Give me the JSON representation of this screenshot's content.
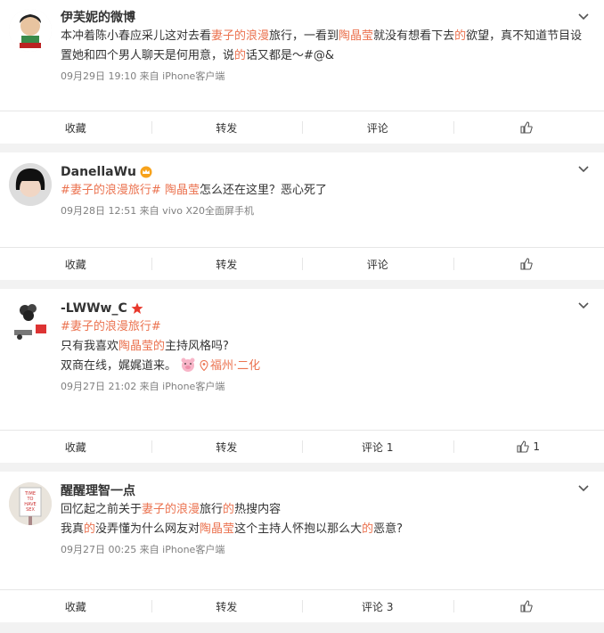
{
  "posts": [
    {
      "author": "伊芙妮的微博",
      "text": [
        [
          "本冲着陈小春应采儿这对去看",
          "",
          "妻子的浪漫",
          "hl",
          "旅行，一看到",
          "",
          "陶晶莹",
          "hl",
          "就没有想看下去",
          "",
          "的",
          "hl",
          "欲望，真不知道节目设置她和四个男人聊天是何用意，说",
          "",
          "的",
          "hl",
          "话又都是～#@&",
          ""
        ]
      ],
      "meta": "09月29日 19:10 来自 iPhone客户端",
      "actions": {
        "fav": "收藏",
        "repost": "转发",
        "comment": "评论",
        "like": ""
      }
    },
    {
      "author": "DanellaWu",
      "text": [
        [
          "#妻子的浪漫旅行#",
          "topic",
          " ",
          "",
          "陶晶莹",
          "hl",
          "怎么还在这里？恶心死了",
          ""
        ]
      ],
      "meta": "09月28日 12:51 来自 vivo X20全面屏手机",
      "actions": {
        "fav": "收藏",
        "repost": "转发",
        "comment": "评论",
        "like": ""
      }
    },
    {
      "author": "-LWWw_C",
      "text": [
        [
          "#妻子的浪漫旅行#",
          "topic"
        ],
        [
          "只有我喜欢",
          "",
          "陶晶莹",
          "hl",
          "的",
          "hl",
          "主持风格吗?",
          ""
        ],
        [
          "双商在线，娓娓道来。",
          ""
        ]
      ],
      "location": "福州·二化",
      "meta": "09月27日 21:02 来自 iPhone客户端",
      "actions": {
        "fav": "收藏",
        "repost": "转发",
        "comment": "评论 1",
        "like": "1"
      }
    },
    {
      "author": "醒醒理智一点",
      "text": [
        [
          "回忆起之前关于",
          "",
          "妻子的浪漫",
          "hl",
          "旅行",
          "",
          "的",
          "hl",
          "热搜内容",
          ""
        ],
        [
          "我真",
          "",
          "的",
          "hl",
          "没弄懂为什么网友对",
          "",
          "陶晶莹",
          "hl",
          "这个主持人怀抱以那么大",
          "",
          "的",
          "hl",
          "恶意?",
          ""
        ]
      ],
      "avatar_text": "TIME TO HAVE SEX",
      "meta": "09月27日 00:25 来自 iPhone客户端",
      "actions": {
        "fav": "收藏",
        "repost": "转发",
        "comment": "评论 3",
        "like": ""
      }
    }
  ],
  "colors": {
    "highlight": "#eb7350",
    "meta": "#808080",
    "bg": "#f2f2f2"
  },
  "icons": {
    "chevron": "chevron-down-icon",
    "like": "thumbs-up-icon",
    "location": "location-pin-icon",
    "vip": "crown-badge-icon",
    "star": "star-badge-icon"
  }
}
